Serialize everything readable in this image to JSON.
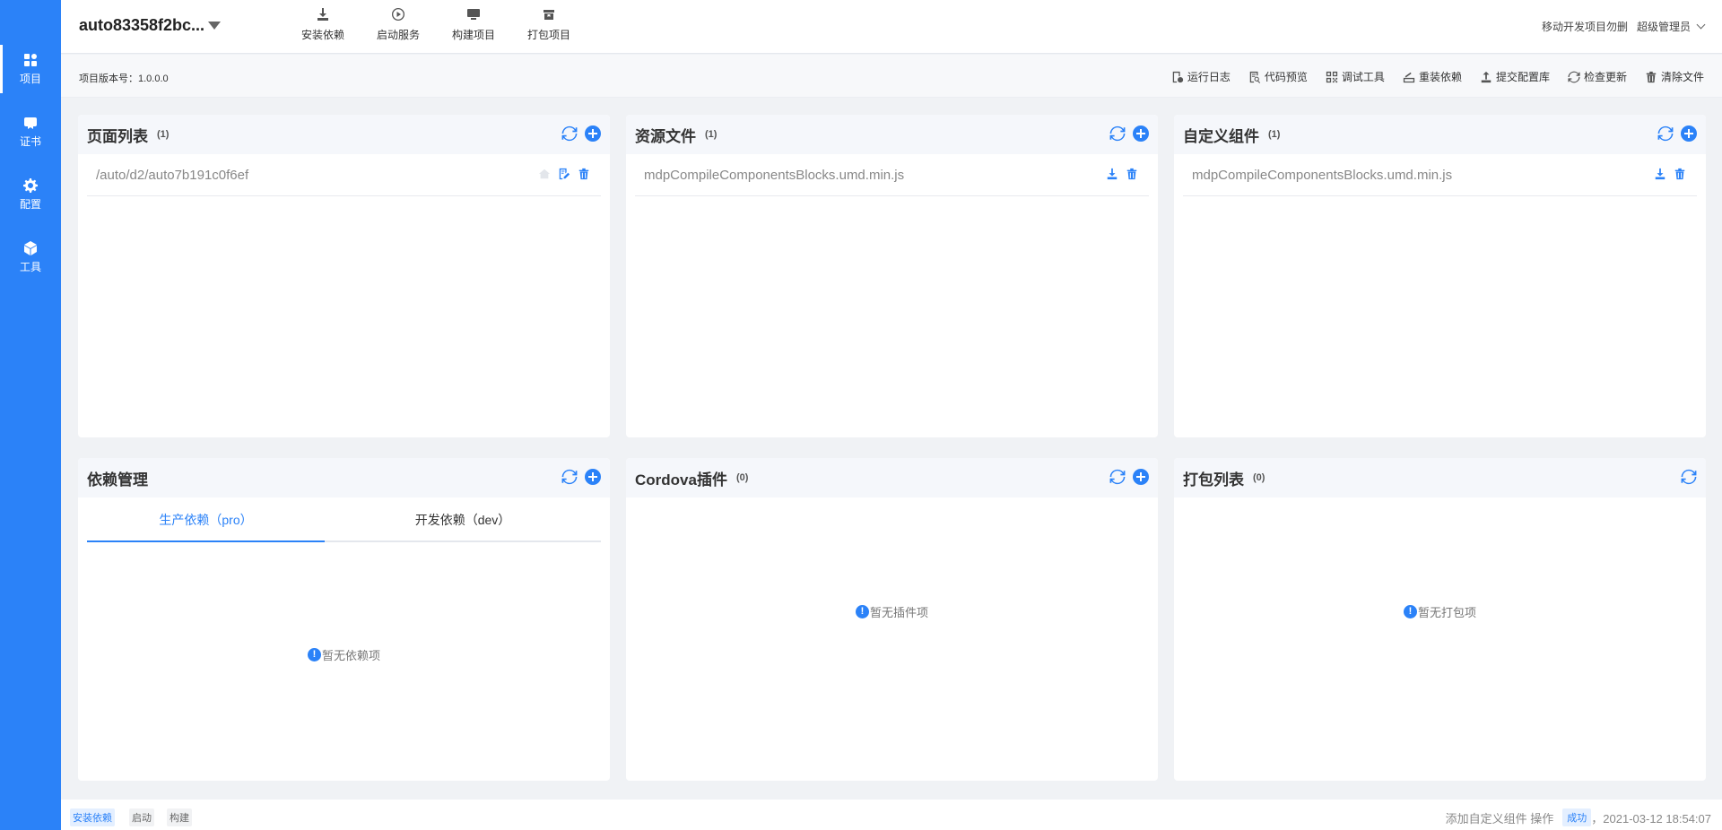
{
  "sidebar": {
    "items": [
      {
        "label": "项目",
        "icon": "grid-icon"
      },
      {
        "label": "证书",
        "icon": "certificate-icon"
      },
      {
        "label": "配置",
        "icon": "gear-icon"
      },
      {
        "label": "工具",
        "icon": "cube-icon"
      }
    ]
  },
  "header": {
    "project_name": "auto83358f2bc...",
    "toolbar": [
      {
        "label": "安装依赖",
        "icon": "download-icon"
      },
      {
        "label": "启动服务",
        "icon": "play-icon"
      },
      {
        "label": "构建项目",
        "icon": "monitor-icon"
      },
      {
        "label": "打包项目",
        "icon": "package-icon"
      }
    ],
    "notice": "移动开发项目勿删",
    "user": "超级管理员"
  },
  "subbar": {
    "version_label": "项目版本号：1.0.0.0",
    "actions": [
      {
        "label": "运行日志",
        "icon": "log-icon"
      },
      {
        "label": "代码预览",
        "icon": "code-preview-icon"
      },
      {
        "label": "调试工具",
        "icon": "debug-icon"
      },
      {
        "label": "重装依赖",
        "icon": "reinstall-icon"
      },
      {
        "label": "提交配置库",
        "icon": "upload-icon"
      },
      {
        "label": "检查更新",
        "icon": "refresh-icon"
      },
      {
        "label": "清除文件",
        "icon": "trash-icon"
      }
    ]
  },
  "panels": {
    "pages": {
      "title": "页面列表",
      "count": "(1)",
      "items": [
        "/auto/d2/auto7b191c0f6ef"
      ]
    },
    "resources": {
      "title": "资源文件",
      "count": "(1)",
      "items": [
        "mdpCompileComponentsBlocks.umd.min.js"
      ]
    },
    "components": {
      "title": "自定义组件",
      "count": "(1)",
      "items": [
        "mdpCompileComponentsBlocks.umd.min.js"
      ]
    },
    "deps": {
      "title": "依赖管理",
      "tabs": [
        "生产依赖（pro）",
        "开发依赖（dev）"
      ],
      "empty": "暂无依赖项"
    },
    "cordova": {
      "title": "Cordova插件",
      "count": "(0)",
      "empty": "暂无插件项"
    },
    "packages": {
      "title": "打包列表",
      "count": "(0)",
      "empty": "暂无打包项"
    }
  },
  "footer": {
    "tags": [
      "安装依赖",
      "启动",
      "构建"
    ],
    "message": "添加自定义组件 操作",
    "status": "成功",
    "timestamp": "，2021-03-12 18:54:07"
  },
  "colors": {
    "accent": "#2b82f8",
    "sidebar_bg": "#2b82f8",
    "page_bg": "#f0f2f5"
  }
}
